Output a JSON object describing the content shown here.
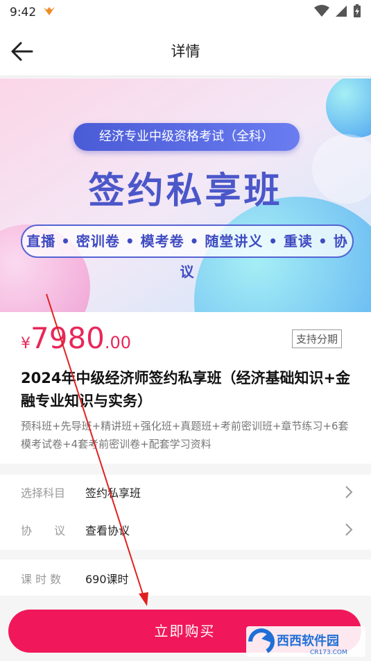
{
  "status_bar": {
    "time": "9:42"
  },
  "nav": {
    "title": "详情"
  },
  "banner": {
    "pill": "经济专业中级资格考试（全科）",
    "heading": "签约私享班",
    "features": "直播 • 密训卷 • 模考卷 • 随堂讲义 • 重读 • 协议"
  },
  "product": {
    "currency": "¥",
    "price_int": "7980",
    "price_dec": ".00",
    "installment_badge": "支持分期",
    "title": "2024年中级经济师签约私享班（经济基础知识+金融专业知识与实务）",
    "description": "预科班+先导班+精讲班+强化班+真题班+考前密训班+章节练习+6套模考试卷+4套考前密训卷+配套学习资料"
  },
  "options": [
    {
      "label": "选择科目",
      "value": "签约私享班"
    },
    {
      "label": "协　　议",
      "value": "查看协议"
    }
  ],
  "hours": {
    "label": "课 时 数",
    "value": "690课时"
  },
  "buy_button": {
    "label": "立即购买"
  },
  "watermark": {
    "text": "西西软件园",
    "url_text": "CR173.COM"
  },
  "colors": {
    "accent": "#f0185a",
    "price": "#e8285a",
    "banner_blue": "#4b57c9",
    "annotation_arrow": "#e02020"
  }
}
